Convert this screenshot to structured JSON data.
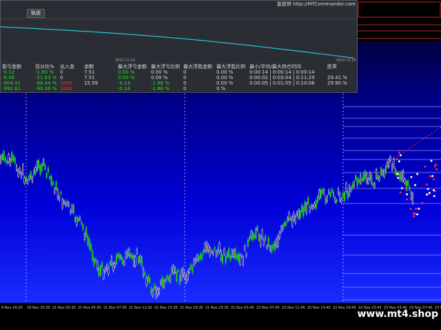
{
  "window": {
    "brand": "复盘侠 http://MTCommander.com",
    "tab_label": "轨迹"
  },
  "equity_chart": {
    "day_labels": [
      "2022.11.23",
      "2022.11.24"
    ],
    "line_color": "#27c7e0"
  },
  "stats_table": {
    "headers": [
      "盈亏金额",
      "百分比%",
      "出入金",
      "余额",
      "最大浮亏金额",
      "最大浮亏比例",
      "最大浮盈金额",
      "最大浮盈比例",
      "最小/平均/最大持仓时间",
      "胜率"
    ],
    "rows": [
      [
        "-0.12",
        "-1.60 %",
        "0",
        "7.51",
        "0.00 %",
        "0.00 %",
        "0",
        "0.00 %",
        "0:00:14 | 0:00:14 | 0:00:14",
        ""
      ],
      [
        "-8.08",
        "-51.83 %",
        "0",
        "7.51",
        "0.00 %",
        "0.00 %",
        "0",
        "0.00 %",
        "0:00:02 | 0:03:04 | 0:11:29",
        "29.41 %"
      ],
      [
        "-904.41",
        "-98.44 %",
        "1000",
        "15.59",
        "-0.14",
        "-1.86 %",
        "0",
        "0.00 %",
        "0:00:05 | 0:01:05 | 0:10:06",
        "29.90 %"
      ],
      [
        "-992.61",
        "-99.26 %",
        "1000",
        "",
        "-0.14",
        "-1.86 %",
        "0",
        "0 %",
        "",
        ""
      ]
    ]
  },
  "price_chart": {
    "bull_color": "#1ec81e",
    "bear_color": "#ffffff",
    "background_top": "#000010",
    "background_bottom": "#1a2cff"
  },
  "time_axis": {
    "labels": [
      "8 Nov 19:30",
      "18 Nov 23:30",
      "21 Nov 03:30",
      "21 Nov 05:30",
      "21 Nov 07:30",
      "21 Nov 11:30",
      "21 Nov 15:30",
      "21 Nov 19:30",
      "21 Nov 23:30",
      "22 Nov 03:45",
      "22 Nov 07:45",
      "22 Nov 11:45",
      "22 Nov 15:45",
      "22 Nov 19:45",
      "22 Nov 23:45",
      "23 Nov 03:45",
      "23 Nov 07:45",
      "23 Nov 12:00"
    ]
  },
  "watermark": "www.mt4.shop"
}
